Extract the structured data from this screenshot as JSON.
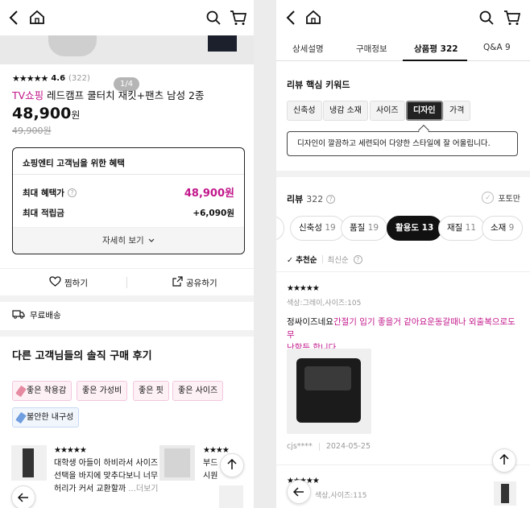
{
  "left": {
    "pager": "1/4",
    "rating": {
      "stars": "★★★★★",
      "score": "4.6",
      "count": "(322)"
    },
    "title_brand": "TV쇼핑",
    "title": "레드캠프 쿨터치 재킷+팬츠 남성 2종",
    "price": "48,900",
    "price_unit": "원",
    "original_price": "49,900원",
    "benefit": {
      "heading": "쇼핑엔티 고객님을 위한 혜택",
      "max_label": "최대 혜택가",
      "max_value": "48,900원",
      "points_label": "최대 적립금",
      "points_value": "+6,090원",
      "more": "자세히 보기"
    },
    "actions": {
      "wish": "찜하기",
      "share": "공유하기"
    },
    "shipping": "무료배송",
    "section_title": "다른 고객님들의 솔직 구매 후기",
    "tags": [
      "좋은 착용감",
      "좋은 가성비",
      "좋은 핏",
      "좋은 사이즈",
      "불안한 내구성"
    ],
    "mini_reviews": [
      {
        "stars": "★★★★★",
        "line1": "대학생 아들이 하비라서 사이즈",
        "line2": "선택을 바지에 맞추다보니 너무",
        "line3": "허리가 커서 교환할까",
        "more": "...더보기"
      },
      {
        "stars": "★★★★",
        "line1": "부드",
        "line2": "시원",
        "line3": ""
      }
    ]
  },
  "right": {
    "tabs": [
      "상세설명",
      "구매정보",
      "상품평 322",
      "Q&A 9"
    ],
    "keyword_title": "리뷰 핵심 키워드",
    "keywords": [
      "신축성",
      "냉감 소재",
      "사이즈",
      "디자인",
      "가격"
    ],
    "keyword_tip": "디자인이 깔끔하고 세련되어 다양한 스타일에 잘 어울립니다.",
    "review_title": "리뷰",
    "review_count": "322",
    "photo_only": "포토만",
    "chips": [
      {
        "label": "신축성",
        "count": "19"
      },
      {
        "label": "품질",
        "count": "19"
      },
      {
        "label": "활용도",
        "count": "13"
      },
      {
        "label": "재질",
        "count": "11"
      },
      {
        "label": "소재",
        "count": "9"
      }
    ],
    "sort": {
      "recommended": "추천순",
      "latest": "최신순"
    },
    "review1": {
      "stars": "★★★★★",
      "option": "색상:그레이,사이즈:105",
      "text_plain": "정싸이즈네요",
      "text_hl1": "간절기 입기 좋을거 같아요운동갈때나 외출복으로도 무",
      "text_hl2": "난할듯 합니다",
      "author": "cjs****",
      "date": "2024-05-25"
    },
    "review2": {
      "stars": "★★★★★",
      "option": "색상,사이즈:115"
    }
  },
  "colors": {
    "accent": "#c2178b",
    "text": "#111111",
    "muted": "#999999"
  },
  "icons": [
    "back-arrow-icon",
    "home-icon",
    "search-icon",
    "cart-icon",
    "heart-icon",
    "share-icon",
    "truck-icon",
    "question-icon",
    "chevron-down-icon",
    "check-icon",
    "arrow-up-icon"
  ]
}
